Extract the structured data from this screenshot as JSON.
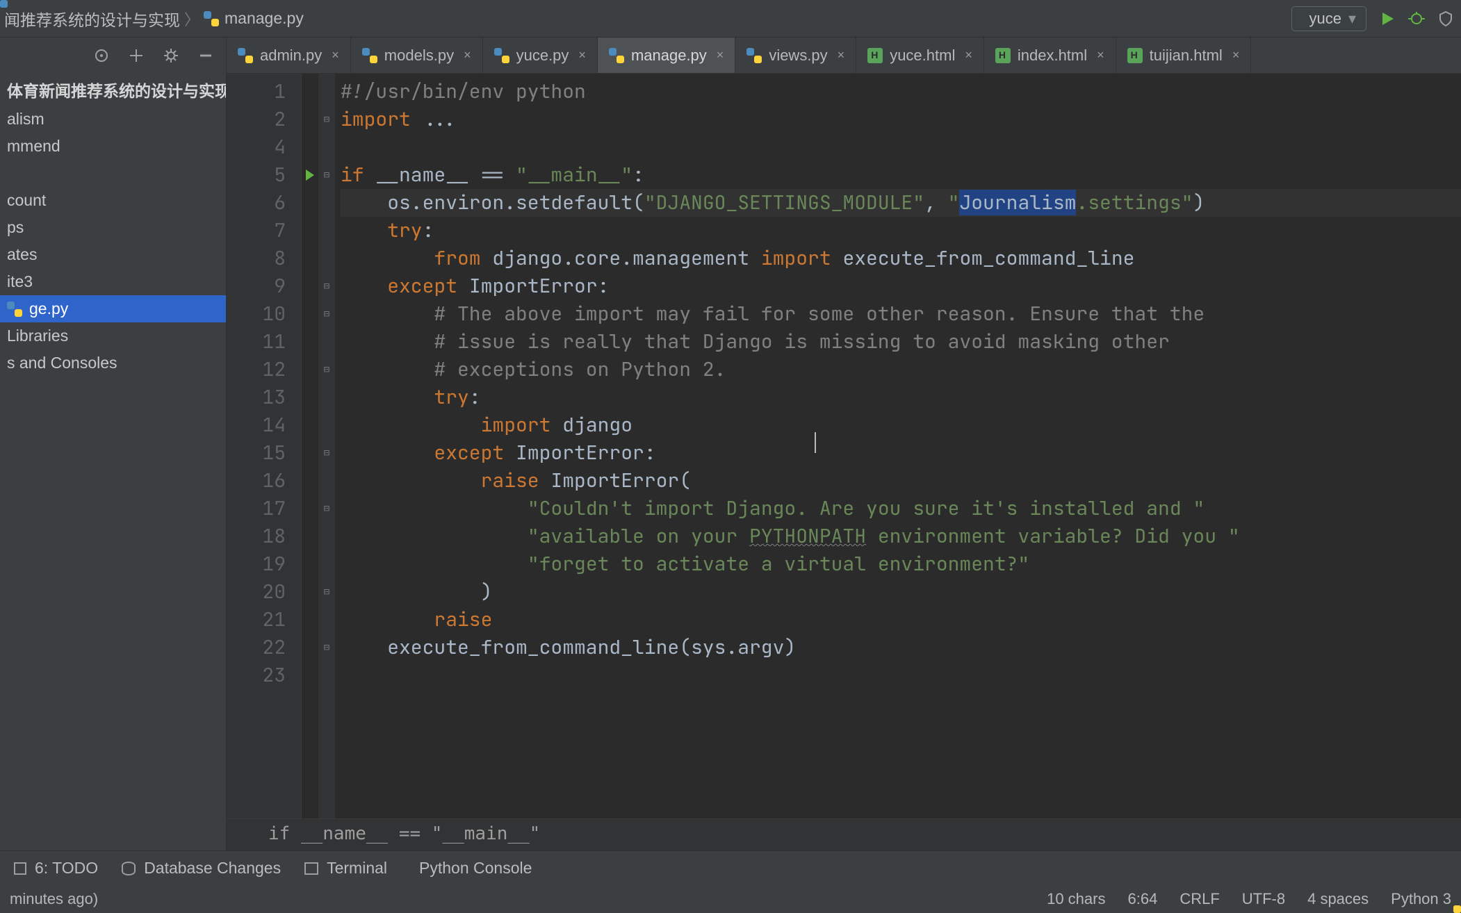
{
  "breadcrumb": {
    "project": "闻推荐系统的设计与实现",
    "file": "manage.py"
  },
  "run_config": {
    "label": "yuce"
  },
  "tabs": [
    {
      "label": "admin.py",
      "icon": "py",
      "active": false
    },
    {
      "label": "models.py",
      "icon": "py",
      "active": false
    },
    {
      "label": "yuce.py",
      "icon": "py",
      "active": false
    },
    {
      "label": "manage.py",
      "icon": "py",
      "active": true
    },
    {
      "label": "views.py",
      "icon": "py",
      "active": false
    },
    {
      "label": "yuce.html",
      "icon": "html",
      "active": false
    },
    {
      "label": "index.html",
      "icon": "html",
      "active": false
    },
    {
      "label": "tuijian.html",
      "icon": "html",
      "active": false
    }
  ],
  "tree": {
    "root": "体育新闻推荐系统的设计与实现",
    "items": [
      "alism",
      "mmend",
      "",
      "count",
      "ps",
      "ates",
      "ite3",
      "ge.py",
      "Libraries",
      "s and Consoles"
    ],
    "selected_index": 7
  },
  "code": {
    "lines": [
      {
        "n": 1,
        "segments": [
          {
            "t": "#!/usr/bin/env python",
            "c": "cmt"
          }
        ]
      },
      {
        "n": 2,
        "segments": [
          {
            "t": "import ",
            "c": "kw"
          },
          {
            "t": "...",
            "c": "id"
          }
        ],
        "fold": "-"
      },
      {
        "n": 4,
        "segments": []
      },
      {
        "n": 5,
        "segments": [
          {
            "t": "if ",
            "c": "kw"
          },
          {
            "t": "__name__ == ",
            "c": "id"
          },
          {
            "t": "\"__main__\"",
            "c": "str"
          },
          {
            "t": ":",
            "c": "id"
          }
        ],
        "fold": "-",
        "run": true
      },
      {
        "n": 6,
        "hl": true,
        "segments": [
          {
            "t": "    os.environ.setdefault(",
            "c": "id"
          },
          {
            "t": "\"DJANGO_SETTINGS_MODULE\"",
            "c": "str"
          },
          {
            "t": ", ",
            "c": "id"
          },
          {
            "t": "\"",
            "c": "str"
          },
          {
            "t": "Journalism",
            "c": "str",
            "sel": true
          },
          {
            "t": ".settings\"",
            "c": "str"
          },
          {
            "t": ")",
            "c": "id"
          }
        ]
      },
      {
        "n": 7,
        "segments": [
          {
            "t": "    ",
            "c": "id"
          },
          {
            "t": "try",
            "c": "kw"
          },
          {
            "t": ":",
            "c": "id"
          }
        ]
      },
      {
        "n": 8,
        "segments": [
          {
            "t": "        ",
            "c": "id"
          },
          {
            "t": "from ",
            "c": "kw"
          },
          {
            "t": "django.core.management ",
            "c": "id"
          },
          {
            "t": "import ",
            "c": "kw"
          },
          {
            "t": "execute_from_command_line",
            "c": "id"
          }
        ]
      },
      {
        "n": 9,
        "segments": [
          {
            "t": "    ",
            "c": "id"
          },
          {
            "t": "except ",
            "c": "kw"
          },
          {
            "t": "ImportError",
            "c": "id"
          },
          {
            "t": ":",
            "c": "id"
          }
        ],
        "fold": "-"
      },
      {
        "n": 10,
        "segments": [
          {
            "t": "        ",
            "c": "id"
          },
          {
            "t": "# The above import may fail for some other reason. Ensure that the",
            "c": "cmt"
          }
        ],
        "fold": "-"
      },
      {
        "n": 11,
        "segments": [
          {
            "t": "        ",
            "c": "id"
          },
          {
            "t": "# issue is really that Django is missing to avoid masking other",
            "c": "cmt"
          }
        ]
      },
      {
        "n": 12,
        "segments": [
          {
            "t": "        ",
            "c": "id"
          },
          {
            "t": "# exceptions on Python 2.",
            "c": "cmt"
          }
        ],
        "fold": "-"
      },
      {
        "n": 13,
        "segments": [
          {
            "t": "        ",
            "c": "id"
          },
          {
            "t": "try",
            "c": "kw"
          },
          {
            "t": ":",
            "c": "id"
          }
        ]
      },
      {
        "n": 14,
        "segments": [
          {
            "t": "            ",
            "c": "id"
          },
          {
            "t": "import ",
            "c": "kw"
          },
          {
            "t": "django",
            "c": "id"
          }
        ]
      },
      {
        "n": 15,
        "segments": [
          {
            "t": "        ",
            "c": "id"
          },
          {
            "t": "except ",
            "c": "kw"
          },
          {
            "t": "ImportError",
            "c": "id"
          },
          {
            "t": ":",
            "c": "id"
          }
        ],
        "fold": "-"
      },
      {
        "n": 16,
        "segments": [
          {
            "t": "            ",
            "c": "id"
          },
          {
            "t": "raise ",
            "c": "kw"
          },
          {
            "t": "ImportError",
            "c": "id"
          },
          {
            "t": "(",
            "c": "id"
          }
        ]
      },
      {
        "n": 17,
        "segments": [
          {
            "t": "                ",
            "c": "id"
          },
          {
            "t": "\"Couldn't import Django. Are you sure it's installed and \"",
            "c": "str"
          }
        ],
        "fold": "-"
      },
      {
        "n": 18,
        "segments": [
          {
            "t": "                ",
            "c": "id"
          },
          {
            "t": "\"available on your ",
            "c": "str"
          },
          {
            "t": "PYTHONPATH",
            "c": "str",
            "wavy": true
          },
          {
            "t": " environment variable? Did you \"",
            "c": "str"
          }
        ]
      },
      {
        "n": 19,
        "segments": [
          {
            "t": "                ",
            "c": "id"
          },
          {
            "t": "\"forget to activate a virtual environment?\"",
            "c": "str"
          }
        ]
      },
      {
        "n": 20,
        "segments": [
          {
            "t": "            )",
            "c": "id"
          }
        ],
        "fold": "-"
      },
      {
        "n": 21,
        "segments": [
          {
            "t": "        ",
            "c": "id"
          },
          {
            "t": "raise",
            "c": "kw"
          }
        ]
      },
      {
        "n": 22,
        "segments": [
          {
            "t": "    execute_from_command_line(sys.argv)",
            "c": "id"
          }
        ],
        "fold": "-"
      },
      {
        "n": 23,
        "segments": []
      }
    ],
    "context": "if __name__ == \"__main__\""
  },
  "bottom_tools": {
    "todo": "6: TODO",
    "db": "Database Changes",
    "terminal": "Terminal",
    "pyconsole": "Python Console"
  },
  "status": {
    "left": "minutes ago)",
    "chars": "10 chars",
    "pos": "6:64",
    "lineend": "CRLF",
    "encoding": "UTF-8",
    "indent": "4 spaces",
    "interp": "Python 3"
  }
}
